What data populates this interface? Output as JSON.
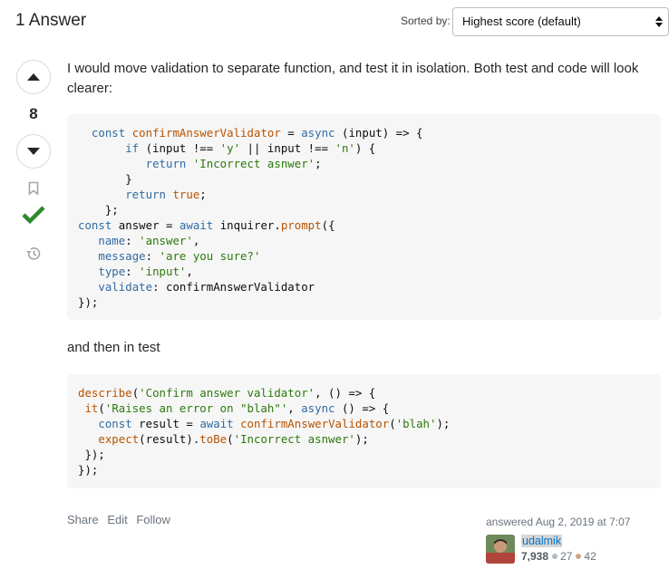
{
  "header": {
    "answer_count_label": "1 Answer",
    "sort_label": "Sorted by:",
    "sort_selected": "Highest score (default)"
  },
  "vote": {
    "score": "8",
    "accepted": true
  },
  "answer": {
    "intro": "I would move validation to separate function, and test it in isolation. Both test and code will look clearer:",
    "mid_text": "and then in test"
  },
  "menu": {
    "share": "Share",
    "edit": "Edit",
    "follow": "Follow"
  },
  "author": {
    "answered": "answered Aug 2, 2019 at 7:07",
    "name": "udalmik",
    "reputation": "7,938",
    "silver_badges": "27",
    "bronze_badges": "42"
  },
  "colors": {
    "accepted_check": "#2f8a2f",
    "link": "#0074cc",
    "silver": "#b4b8bc",
    "bronze": "#d1a684"
  }
}
